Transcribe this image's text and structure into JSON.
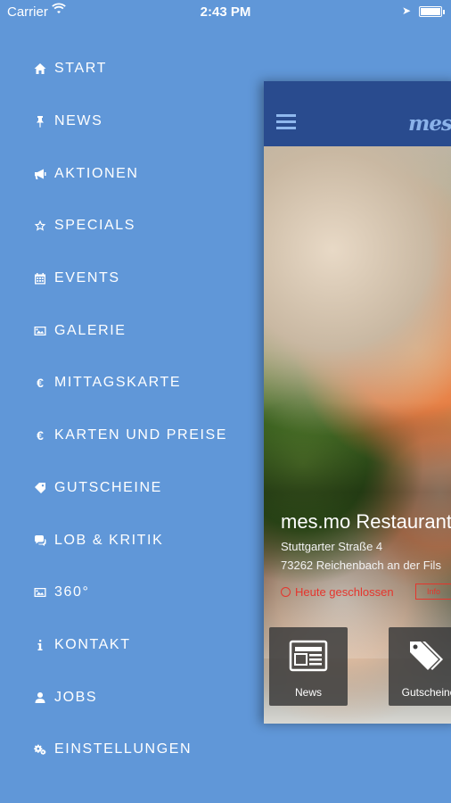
{
  "status_bar": {
    "carrier": "Carrier",
    "time": "2:43 PM"
  },
  "menu": {
    "items": [
      {
        "label": "START",
        "icon": "home-icon"
      },
      {
        "label": "NEWS",
        "icon": "pin-icon"
      },
      {
        "label": "AKTIONEN",
        "icon": "megaphone-icon"
      },
      {
        "label": "SPECIALS",
        "icon": "star-icon"
      },
      {
        "label": "EVENTS",
        "icon": "calendar-icon"
      },
      {
        "label": "GALERIE",
        "icon": "image-icon"
      },
      {
        "label": "MITTAGSKARTE",
        "icon": "euro-icon"
      },
      {
        "label": "KARTEN UND PREISE",
        "icon": "euro-icon"
      },
      {
        "label": "GUTSCHEINE",
        "icon": "tag-icon"
      },
      {
        "label": "LOB & KRITIK",
        "icon": "comments-icon"
      },
      {
        "label": "360°",
        "icon": "image-icon"
      },
      {
        "label": "KONTAKT",
        "icon": "info-icon"
      },
      {
        "label": "JOBS",
        "icon": "user-icon"
      },
      {
        "label": "EINSTELLUNGEN",
        "icon": "cogs-icon"
      }
    ]
  },
  "app": {
    "logo": "mesmo",
    "restaurant_name": "mes.mo Restaurant",
    "address_street": "Stuttgarter Straße 4",
    "address_city": "73262 Reichenbach an der Fils",
    "status_text": "Heute geschlossen",
    "status_badge": "Info",
    "tiles": [
      {
        "label": "News",
        "icon": "newspaper-icon"
      },
      {
        "label": "Gutscheine",
        "icon": "tags-icon"
      }
    ]
  },
  "colors": {
    "menu_bg": "#6097d8",
    "navbar_bg": "#294b8e",
    "closed_red": "#e5352d"
  }
}
